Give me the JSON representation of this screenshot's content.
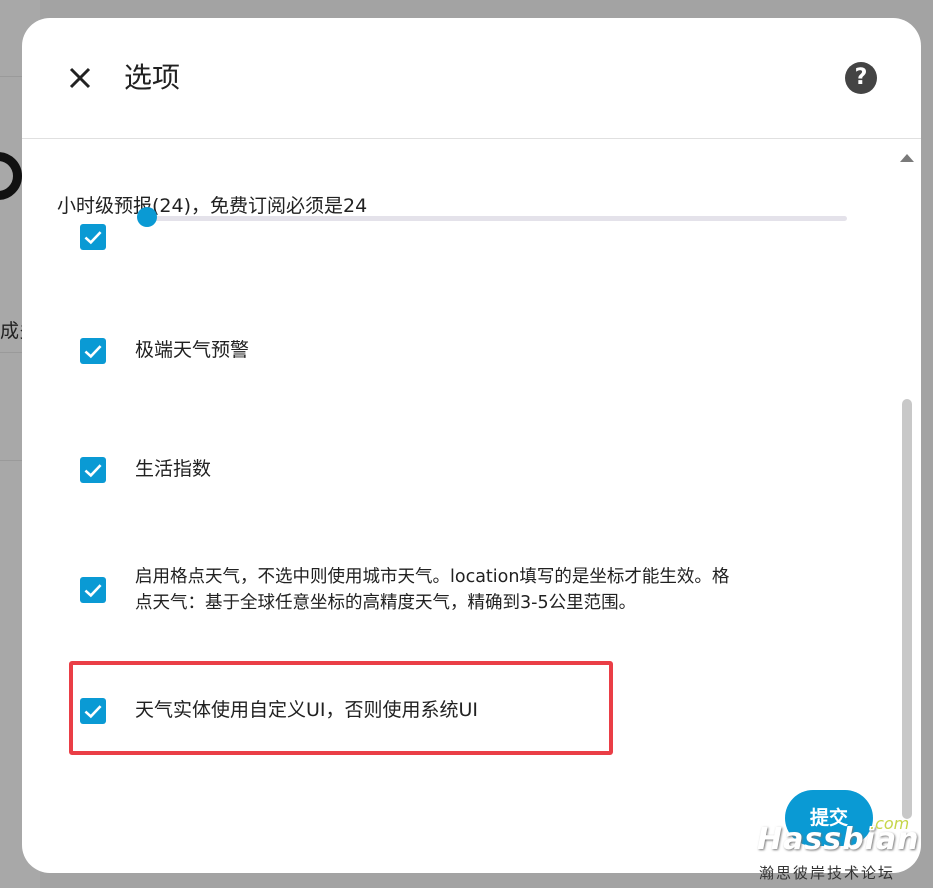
{
  "dialog": {
    "title": "选项",
    "help_icon": "help-circle-icon",
    "close_icon": "close-icon"
  },
  "slider": {
    "label": "小时级预报(24)，免费订阅必须是24",
    "value_fraction": 0.0
  },
  "options": [
    {
      "label": "",
      "checked": true
    },
    {
      "label": "极端天气预警",
      "checked": true
    },
    {
      "label": "生活指数",
      "checked": true
    },
    {
      "label_line1": "启用格点天气，不选中则使用城市天气。location填写的是坐标才能生效。格",
      "label_line2": "点天气：基于全球任意坐标的高精度天气，精确到3-5公里范围。",
      "checked": true
    },
    {
      "label": "天气实体使用自定义UI，否则使用系统UI",
      "checked": true
    }
  ],
  "submit_label": "提交",
  "background": {
    "partial_text": "成多"
  },
  "watermark": {
    "brand": "Hassbian",
    "domain": ".com",
    "subtitle": "瀚思彼岸技术论坛"
  },
  "colors": {
    "accent": "#0a9ad4",
    "highlight": "#ea3e46"
  }
}
